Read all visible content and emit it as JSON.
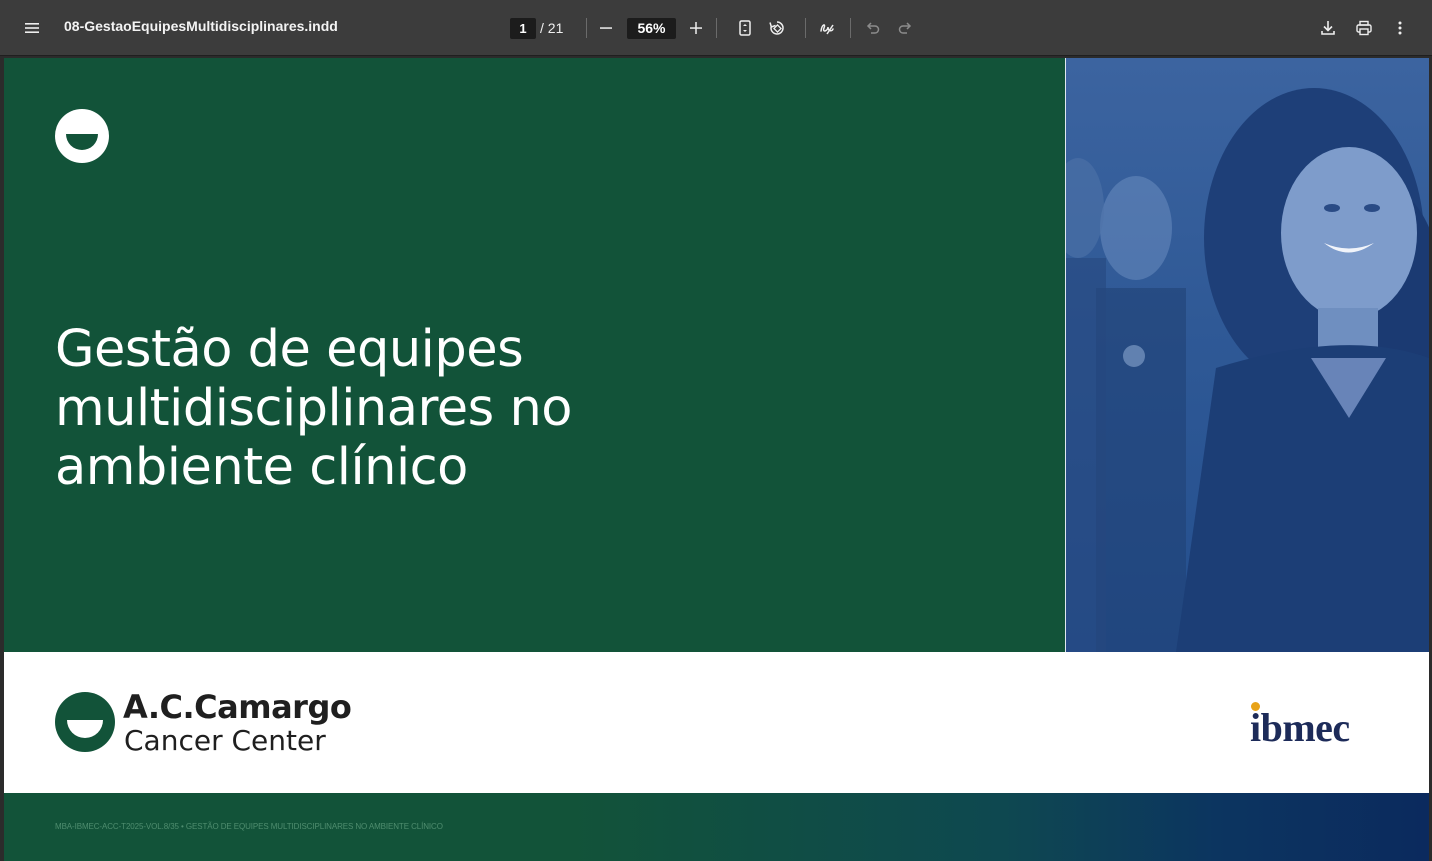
{
  "toolbar": {
    "menu_icon": "hamburger-menu-icon",
    "title": "08-GestaoEquipesMultidisciplinares.indd",
    "page_current": "1",
    "page_total": "/ 21",
    "zoom": "56%",
    "icons": [
      "minus-icon",
      "plus-icon",
      "fit-page-icon",
      "rotate-icon",
      "annotate-icon",
      "undo-icon",
      "redo-icon",
      "download-icon",
      "print-icon",
      "more-vert-icon"
    ]
  },
  "document": {
    "title_lines": [
      "Gestão de equipes",
      "multidisciplinares no",
      "ambiente clínico"
    ],
    "brand_name": "A.C.Camargo",
    "brand_sub": "Cancer Center",
    "partner_logo_text": "ibmec",
    "footer_text": "MBA-IBMEC-ACC-T2025-VOL.8/35 • GESTÃO DE EQUIPES MULTIDISCIPLINARES NO AMBIENTE CLÍNICO"
  },
  "colors": {
    "toolbar_bg": "#3c3c3c",
    "green": "#125339",
    "blue_overlay": "#2f5996",
    "ibmec_navy": "#1d2b59",
    "ibmec_gold": "#e8a318"
  }
}
